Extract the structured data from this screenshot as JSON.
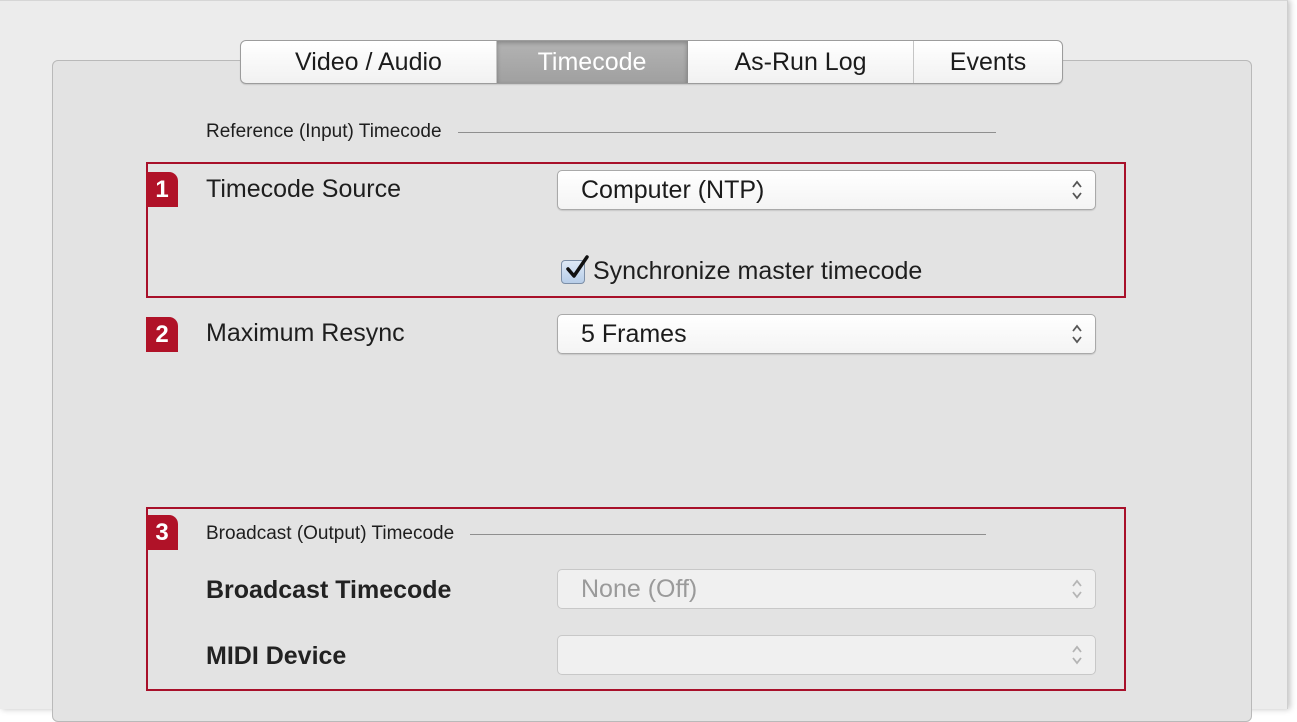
{
  "tabs": [
    {
      "label": "Video / Audio",
      "selected": false
    },
    {
      "label": "Timecode",
      "selected": true
    },
    {
      "label": "As-Run Log",
      "selected": false
    },
    {
      "label": "Events",
      "selected": false
    }
  ],
  "reference": {
    "heading": "Reference (Input) Timecode",
    "timecode_source_label": "Timecode Source",
    "timecode_source_value": "Computer (NTP)",
    "sync_checkbox_label": "Synchronize master timecode",
    "sync_checked": true,
    "max_resync_label": "Maximum Resync",
    "max_resync_value": "5 Frames"
  },
  "broadcast": {
    "heading": "Broadcast (Output) Timecode",
    "broadcast_timecode_label": "Broadcast Timecode",
    "broadcast_timecode_value": "None (Off)",
    "midi_device_label": "MIDI Device",
    "midi_device_value": ""
  },
  "callouts": {
    "badge_1": "1",
    "badge_2": "2",
    "badge_3": "3"
  },
  "colors": {
    "callout_red": "#b01228",
    "selected_tab": "#a8a8a8",
    "window_bg": "#ececec"
  },
  "icons": {
    "popup_arrows": "up-down-chevron-icon",
    "checkmark": "checkmark-icon"
  }
}
